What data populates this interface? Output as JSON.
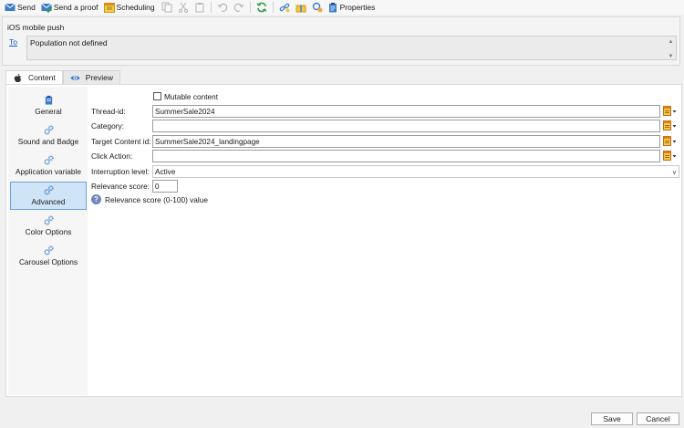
{
  "toolbar": {
    "send_label": "Send",
    "send_proof_label": "Send a proof",
    "scheduling_label": "Scheduling",
    "properties_label": "Properties"
  },
  "header": {
    "title": "iOS mobile push",
    "to_link": "To",
    "population_text": "Population not defined"
  },
  "tabs": [
    {
      "label": "Content",
      "icon": "apple-icon",
      "active": true
    },
    {
      "label": "Preview",
      "icon": "eye-icon",
      "active": false
    }
  ],
  "sidebar": {
    "items": [
      {
        "label": "General",
        "icon": "clipboard-icon"
      },
      {
        "label": "Sound and Badge",
        "icon": "gears-icon"
      },
      {
        "label": "Application variable",
        "icon": "gears-icon"
      },
      {
        "label": "Advanced",
        "icon": "gears-icon",
        "active": true
      },
      {
        "label": "Color Options",
        "icon": "gears-icon"
      },
      {
        "label": "Carousel Options",
        "icon": "gears-icon"
      }
    ]
  },
  "form": {
    "mutable_content_label": "Mutable content",
    "mutable_content_checked": false,
    "thread_id_label": "Thread-id:",
    "thread_id_value": "SummerSale2024",
    "category_label": "Category:",
    "category_value": "",
    "target_content_label": "Target Content id:",
    "target_content_value": "SummerSale2024_landingpage",
    "click_action_label": "Click Action:",
    "click_action_value": "",
    "interruption_label": "Interruption level:",
    "interruption_value": "Active",
    "relevance_label": "Relevance score:",
    "relevance_value": "0",
    "relevance_help": "Relevance score (0-100) value"
  },
  "footer": {
    "save_label": "Save",
    "cancel_label": "Cancel"
  },
  "colors": {
    "accent": "#1155cc",
    "selected_bg": "#cfe4f7",
    "selected_border": "#6aa3d8"
  }
}
